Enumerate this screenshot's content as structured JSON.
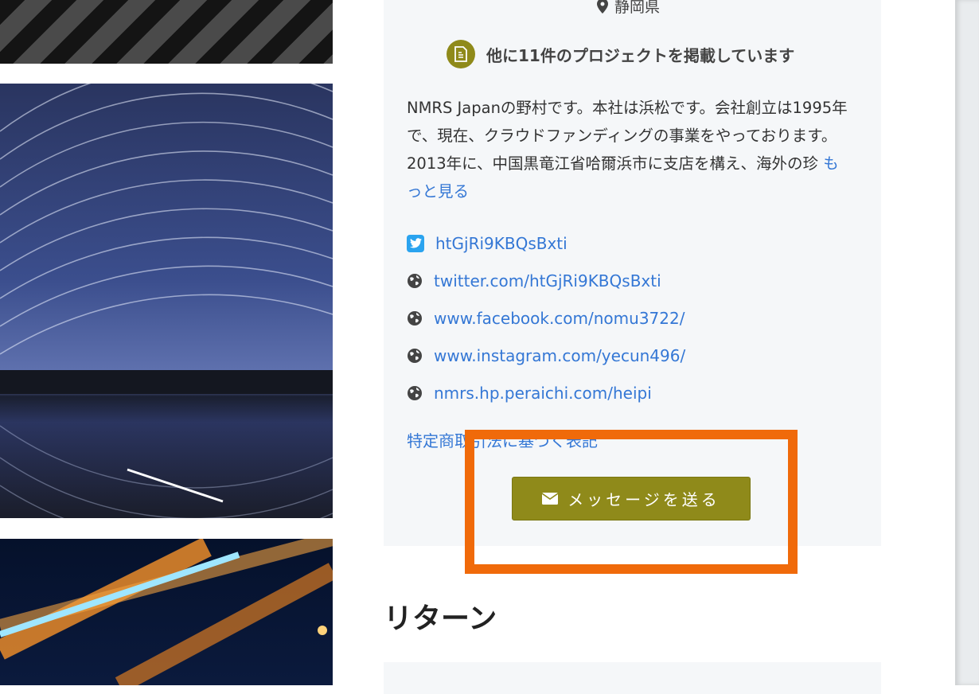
{
  "profile": {
    "location": "静岡県",
    "projects_text": "他に11件のプロジェクトを掲載しています",
    "bio": "NMRS Japanの野村です。本社は浜松です。会社創立は1995年で、現在、クラウドファンディングの事業をやっております。2013年に、中国黒竜江省哈爾浜市に支店を構え、海外の珍",
    "more_link": "もっと見る",
    "links": [
      {
        "icon": "twitter-icon",
        "text": "htGjRi9KBQsBxti"
      },
      {
        "icon": "globe-icon",
        "text": "twitter.com/htGjRi9KBQsBxti"
      },
      {
        "icon": "globe-icon",
        "text": "www.facebook.com/nomu3722/"
      },
      {
        "icon": "globe-icon",
        "text": "www.instagram.com/yecun496/"
      },
      {
        "icon": "globe-icon",
        "text": "nmrs.hp.peraichi.com/heipi"
      }
    ],
    "law_link": "特定商取引法に基づく表記",
    "message_button": "メッセージを送る"
  },
  "section_title": "リターン",
  "colors": {
    "accent": "#8f8a1a",
    "link": "#3477d5",
    "highlight": "#f06a0a",
    "card_bg": "#f5f7f9"
  }
}
